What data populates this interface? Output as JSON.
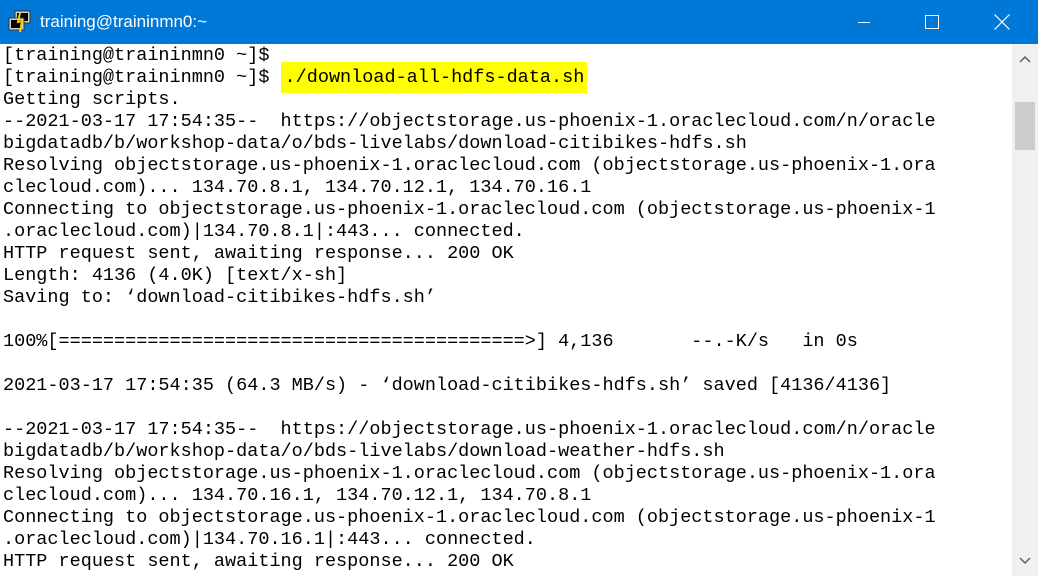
{
  "window": {
    "title": "training@traininmn0:~",
    "icon": "putty-terminal-icon",
    "controls": [
      "minimize-icon",
      "maximize-icon",
      "close-icon"
    ]
  },
  "colors": {
    "titlebar": "#0078d7",
    "highlight": "#ffff00",
    "text": "#000000",
    "background": "#ffffff"
  },
  "terminal": {
    "lines": [
      "[training@traininmn0 ~]$",
      "[training@traininmn0 ~]$ ",
      "Getting scripts.",
      "--2021-03-17 17:54:35--  https://objectstorage.us-phoenix-1.oraclecloud.com/n/oracle",
      "bigdatadb/b/workshop-data/o/bds-livelabs/download-citibikes-hdfs.sh",
      "Resolving objectstorage.us-phoenix-1.oraclecloud.com (objectstorage.us-phoenix-1.ora",
      "clecloud.com)... 134.70.8.1, 134.70.12.1, 134.70.16.1",
      "Connecting to objectstorage.us-phoenix-1.oraclecloud.com (objectstorage.us-phoenix-1",
      ".oraclecloud.com)|134.70.8.1|:443... connected.",
      "HTTP request sent, awaiting response... 200 OK",
      "Length: 4136 (4.0K) [text/x-sh]",
      "Saving to: ‘download-citibikes-hdfs.sh’",
      "",
      "100%[==========================================>] 4,136       --.-K/s   in 0s",
      "",
      "2021-03-17 17:54:35 (64.3 MB/s) - ‘download-citibikes-hdfs.sh’ saved [4136/4136]",
      "",
      "--2021-03-17 17:54:35--  https://objectstorage.us-phoenix-1.oraclecloud.com/n/oracle",
      "bigdatadb/b/workshop-data/o/bds-livelabs/download-weather-hdfs.sh",
      "Resolving objectstorage.us-phoenix-1.oraclecloud.com (objectstorage.us-phoenix-1.ora",
      "clecloud.com)... 134.70.16.1, 134.70.12.1, 134.70.8.1",
      "Connecting to objectstorage.us-phoenix-1.oraclecloud.com (objectstorage.us-phoenix-1",
      ".oraclecloud.com)|134.70.16.1|:443... connected.",
      "HTTP request sent, awaiting response... 200 OK"
    ],
    "highlighted_command": "./download-all-hdfs-data.sh"
  },
  "scrollbar": {
    "icons": [
      "scroll-up-arrow-icon",
      "scroll-down-arrow-icon"
    ]
  }
}
